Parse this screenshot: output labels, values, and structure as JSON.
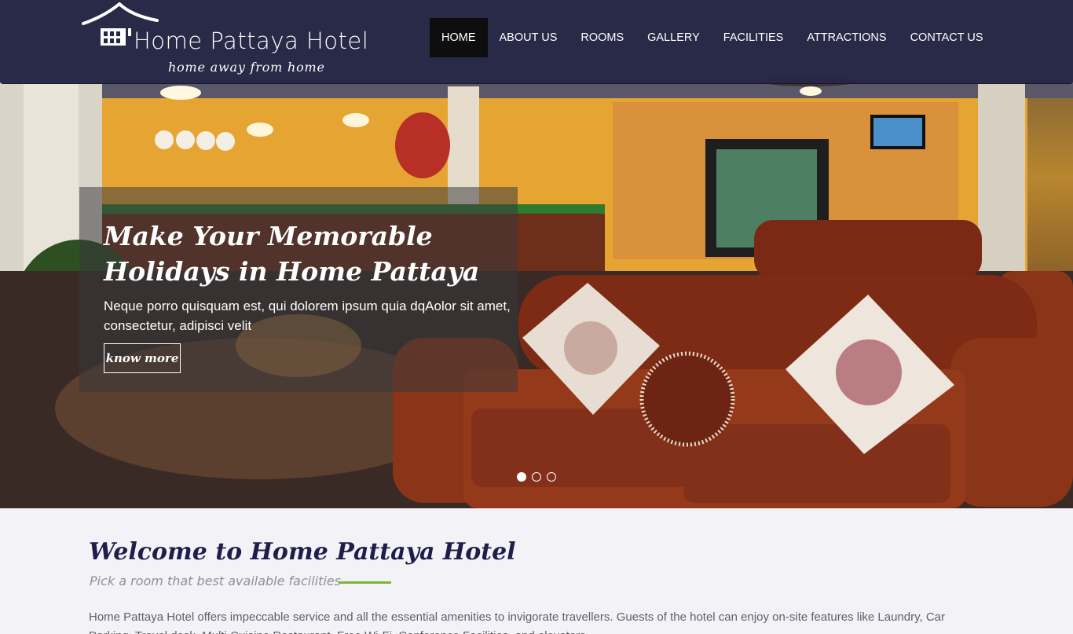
{
  "header": {
    "logo_title": "Home Pattaya Hotel",
    "logo_tagline": "home away from home",
    "nav": [
      {
        "label": "HOME",
        "active": true
      },
      {
        "label": "ABOUT US"
      },
      {
        "label": "ROOMS"
      },
      {
        "label": "GALLERY"
      },
      {
        "label": "FACILITIES"
      },
      {
        "label": "ATTRACTIONS"
      },
      {
        "label": "CONTACT US"
      }
    ]
  },
  "hero": {
    "title": "Make Your Memorable Holidays in Home Pattaya",
    "text": "Neque porro quisquam est, qui dolorem ipsum quia dqAolor sit amet, consectetur, adipisci velit",
    "button_label": "know more",
    "slides": {
      "count": 3,
      "active_index": 0
    }
  },
  "welcome": {
    "title": "Welcome to Home Pattaya Hotel",
    "subtitle": "Pick a room that best available facilities",
    "text": "Home Pattaya Hotel offers impeccable service and all the essential amenities to invigorate travellers. Guests of the hotel can enjoy on-site features like Laundry, Car Parking, Travel desk, Multi Cuisine Restaurant, Free Wi-Fi, Conference Facilities, and elevators."
  },
  "colors": {
    "header_bg": "#262646",
    "nav_active_bg": "#0e0e0e",
    "title_navy": "#1f1d4a",
    "accent_green": "#7fb23a",
    "body_text": "#5f5f6a"
  },
  "icons": {
    "logo": "house-roof-logo-icon"
  }
}
